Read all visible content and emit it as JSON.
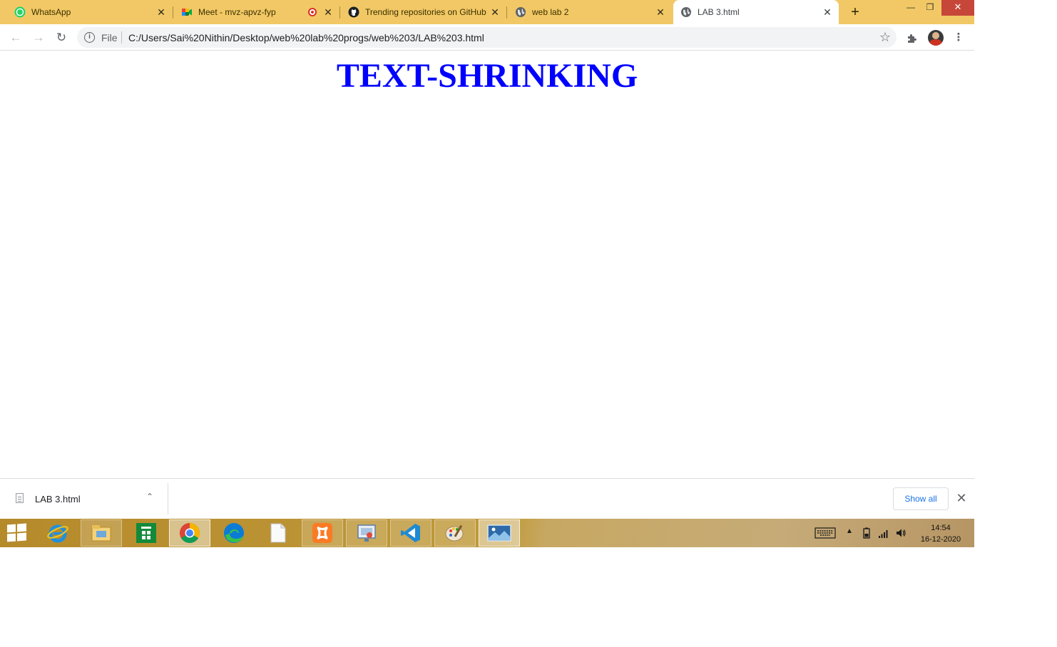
{
  "browser": {
    "tabs": [
      {
        "title": "WhatsApp",
        "icon": "whatsapp-icon",
        "active": false
      },
      {
        "title": "Meet - mvz-apvz-fyp",
        "icon": "google-meet-icon",
        "recording": true,
        "active": false
      },
      {
        "title": "Trending repositories on GitHub",
        "icon": "github-icon",
        "active": false
      },
      {
        "title": "web lab 2",
        "icon": "globe-icon",
        "active": false
      },
      {
        "title": "LAB 3.html",
        "icon": "globe-icon",
        "active": true
      }
    ],
    "address_bar": {
      "scheme_label": "File",
      "url": "C:/Users/Sai%20Nithin/Desktop/web%20lab%20progs/web%203/LAB%203.html"
    }
  },
  "page": {
    "heading": "TEXT-SHRINKING",
    "heading_color": "#0000ff"
  },
  "download_shelf": {
    "item_name": "LAB 3.html",
    "show_all_label": "Show all"
  },
  "taskbar": {
    "apps": [
      "start-button",
      "internet-explorer",
      "file-explorer",
      "store",
      "chrome",
      "edge",
      "notepad",
      "xampp",
      "snipping-tool",
      "vscode",
      "paint",
      "photos"
    ],
    "time": "14:54",
    "date": "16-12-2020"
  },
  "colors": {
    "tab_strip": "#f1c865",
    "accent_link": "#1a73e8"
  }
}
